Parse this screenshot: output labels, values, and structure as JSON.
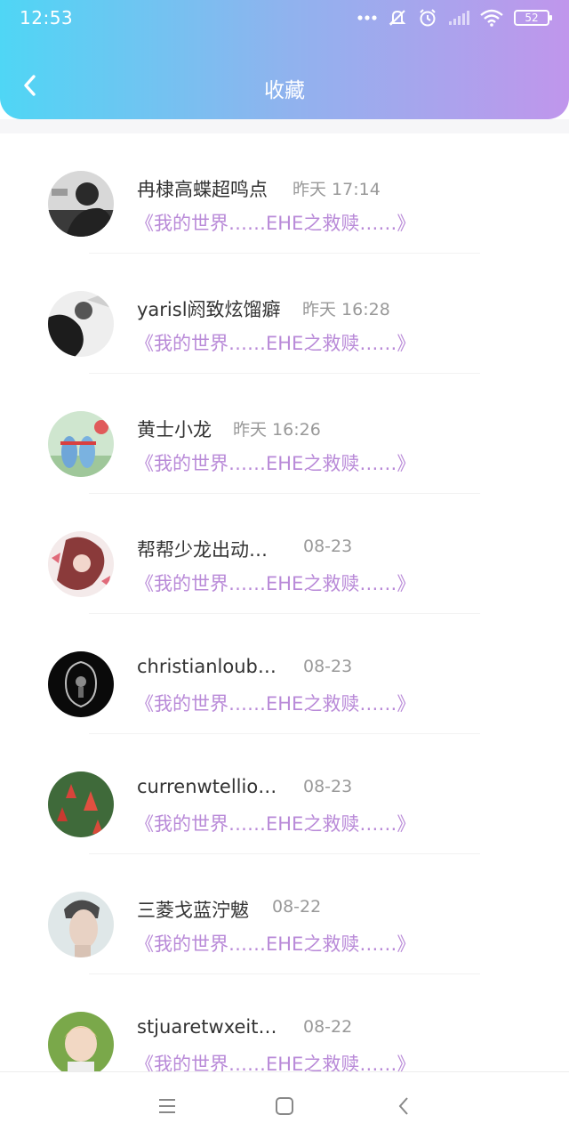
{
  "status_bar": {
    "time": "12:53",
    "battery": "52",
    "icons": [
      "more-dots-icon",
      "mute-icon",
      "alarm-icon",
      "signal-icon",
      "wifi-icon",
      "battery-icon"
    ]
  },
  "header": {
    "title": "收藏",
    "back_icon": "chevron-left-icon"
  },
  "colors": {
    "gradient_start": "#4fd6f5",
    "gradient_end": "#c096ec",
    "preview_text": "#b98ad8",
    "name_text": "#333333",
    "time_text": "#999999"
  },
  "items": [
    {
      "name": "冉棣高蝶超鸣点",
      "time": "昨天 17:14",
      "preview": "《我的世界……EHE之救赎……》"
    },
    {
      "name": "yarisl阏致炫馏癖",
      "time": "昨天 16:28",
      "preview": "《我的世界……EHE之救赎……》"
    },
    {
      "name": "黄士小龙",
      "time": "昨天 16:26",
      "preview": "《我的世界……EHE之救赎……》"
    },
    {
      "name": "帮帮少龙出动…",
      "time": "08-23",
      "preview": "《我的世界……EHE之救赎……》"
    },
    {
      "name": "christianloub…",
      "time": "08-23",
      "preview": "《我的世界……EHE之救赎……》"
    },
    {
      "name": "currenwtellio…",
      "time": "08-23",
      "preview": "《我的世界……EHE之救赎……》"
    },
    {
      "name": "三菱戈蓝泞魃",
      "time": "08-22",
      "preview": "《我的世界……EHE之救赎……》"
    },
    {
      "name": "stjuaretwxeit…",
      "time": "08-22",
      "preview": "《我的世界……EHE之救赎……》"
    }
  ],
  "system_nav": {
    "icons": [
      "menu-icon",
      "home-square-icon",
      "back-chevron-icon"
    ]
  }
}
